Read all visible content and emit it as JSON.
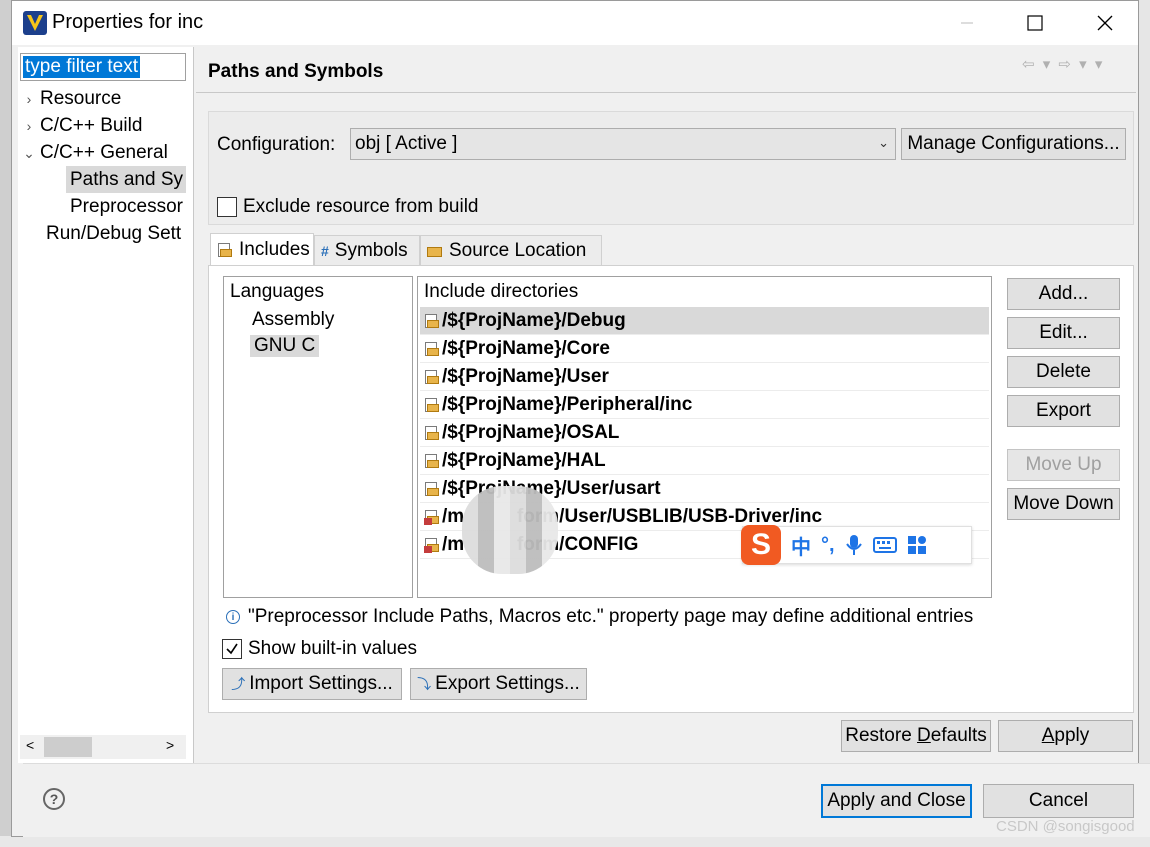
{
  "window": {
    "title": "Properties for inc",
    "buttons": {
      "minimize_icon": "minimize-icon",
      "maximize_icon": "maximize-icon",
      "close_icon": "close-icon"
    }
  },
  "sidebar": {
    "filter_placeholder": "type filter text",
    "items": [
      {
        "label": "Resource",
        "expand": "›"
      },
      {
        "label": "C/C++ Build",
        "expand": "›"
      },
      {
        "label": "C/C++ General",
        "expand": "⌄"
      },
      {
        "label": "Paths and Sy"
      },
      {
        "label": "Preprocessor"
      },
      {
        "label": "Run/Debug Sett"
      }
    ],
    "selected_index": 3
  },
  "page": {
    "title": "Paths and Symbols",
    "nav_arrows": "⇦ ▾ ⇨ ▾ ▾"
  },
  "config": {
    "label": "Configuration:",
    "value": "obj  [ Active ]",
    "manage_button": "Manage Configurations...",
    "exclude_label": "Exclude resource from build",
    "exclude_checked": false
  },
  "tabs": [
    {
      "label": "Includes",
      "icon": "includes-icon",
      "active": true
    },
    {
      "label": "Symbols",
      "icon": "#",
      "active": false
    },
    {
      "label": "Source Location",
      "icon": "folder-icon",
      "active": false
    }
  ],
  "languages": {
    "header": "Languages",
    "items": [
      "Assembly",
      "GNU C"
    ],
    "selected": "GNU C"
  },
  "includes": {
    "header": "Include directories",
    "rows": [
      {
        "path": "/${ProjName}/Debug",
        "selected": true,
        "icon": "include-folder-icon"
      },
      {
        "path": "/${ProjName}/Core",
        "icon": "include-folder-icon"
      },
      {
        "path": "/${ProjName}/User",
        "icon": "include-folder-icon"
      },
      {
        "path": "/${ProjName}/Peripheral/inc",
        "icon": "include-folder-icon"
      },
      {
        "path": "/${ProjName}/OSAL",
        "icon": "include-folder-icon"
      },
      {
        "path": "/${ProjName}/HAL",
        "icon": "include-folder-icon"
      },
      {
        "path": "/${ProjName}/User/usart",
        "icon": "include-folder-icon"
      },
      {
        "path": "/m          form/User/USBLIB/USB-Driver/inc",
        "icon": "workspace-folder-icon"
      },
      {
        "path": "/m          form/CONFIG",
        "icon": "workspace-folder-icon"
      }
    ]
  },
  "side_buttons": {
    "add": "Add...",
    "edit": "Edit...",
    "delete": "Delete",
    "export": "Export",
    "move_up": "Move Up",
    "move_down": "Move Down"
  },
  "ime_bar": {
    "logo": "S",
    "items": [
      "中",
      "°,",
      "mic-icon",
      "keyboard-icon",
      "apps-icon"
    ]
  },
  "info_text": "\"Preprocessor Include Paths, Macros etc.\" property page may define additional entries",
  "builtin": {
    "label": "Show built-in values",
    "checked": true
  },
  "bottom_buttons": {
    "import": "Import Settings...",
    "export": "Export Settings...",
    "restore_pre": "Restore ",
    "restore_u": "D",
    "restore_post": "efaults",
    "apply_u": "A",
    "apply_post": "pply"
  },
  "footer": {
    "apply_close": "Apply and Close",
    "cancel": "Cancel",
    "help": "?"
  },
  "watermark": "CSDN @songisgood",
  "colors": {
    "accent": "#0078d7",
    "selection": "#d9d9d9",
    "ime": "#f15a22"
  }
}
